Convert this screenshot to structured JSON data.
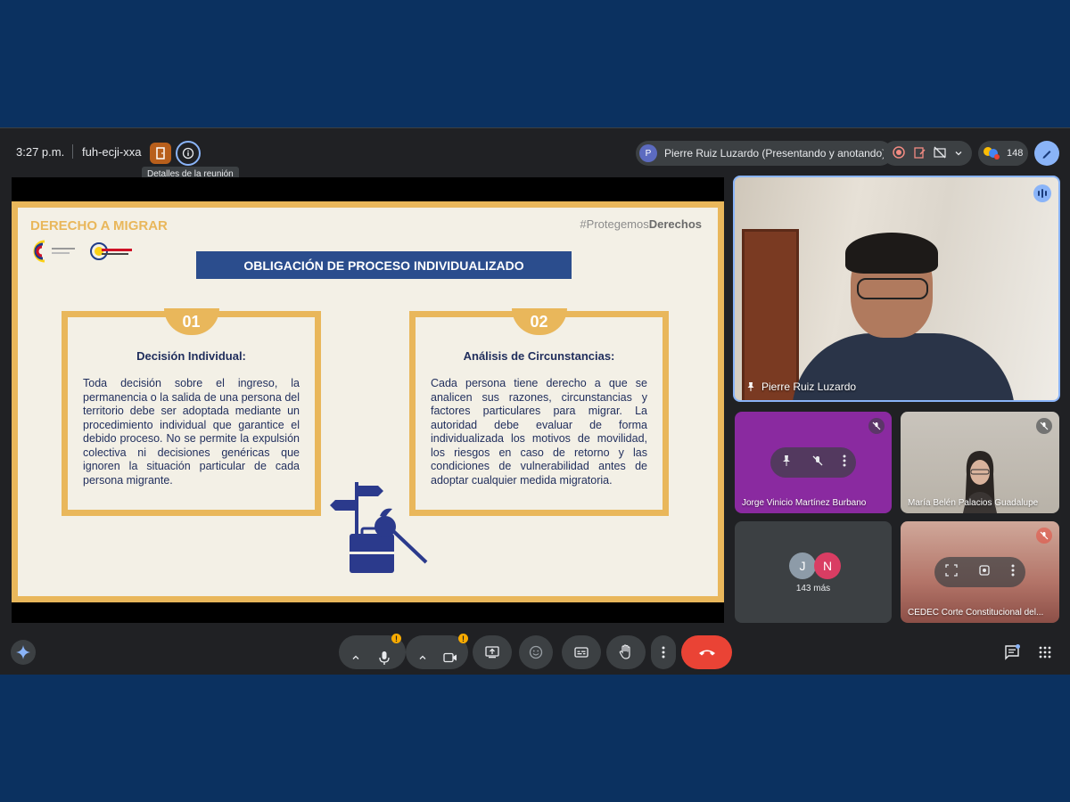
{
  "meeting": {
    "time": "3:27 p.m.",
    "code": "fuh-ecji-xxa",
    "tooltip": "Detalles de la reunión",
    "presenter_initial": "P",
    "presenter_label": "Pierre Ruiz Luzardo (Presentando y anotando)",
    "participant_count": "148"
  },
  "slide": {
    "title": "DERECHO A MIGRAR",
    "hashtag_prefix": "#Protegemos",
    "hashtag_bold": "Derechos",
    "header": "OBLIGACIÓN DE PROCESO INDIVIDUALIZADO",
    "cards": [
      {
        "num": "01",
        "title": "Decisión Individual:",
        "body": "Toda decisión sobre el ingreso, la permanencia o la salida de una persona del territorio debe ser adoptada mediante un procedimiento individual que garantice el debido proceso. No se permite la expulsión colectiva ni decisiones genéricas que ignoren la situación particular de cada persona migrante."
      },
      {
        "num": "02",
        "title": "Análisis de Circunstancias:",
        "body": "Cada persona tiene derecho a que se analicen sus razones, circunstancias y factores particulares para migrar. La autoridad debe evaluar de forma individualizada los motivos de movilidad, los riesgos en caso de retorno y las condiciones de vulnerabilidad antes de adoptar cualquier medida migratoria."
      }
    ]
  },
  "tiles": {
    "main_name": "Pierre Ruiz Luzardo",
    "t2_name": "Jorge Vinicio Martínez Burbano",
    "t3_name": "María Belén Palacios Guadalupe",
    "t4_avatars": [
      "J",
      "N"
    ],
    "t4_more": "143 más",
    "t5_name": "CEDEC Corte Constitucional del..."
  },
  "colors": {
    "accent_gold": "#e9b75b",
    "slide_navy": "#2b4d8d",
    "hangup_red": "#ea4335",
    "meet_blue": "#8ab4f8"
  }
}
